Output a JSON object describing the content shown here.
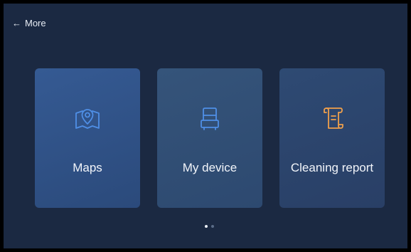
{
  "header": {
    "back_icon": "arrow-left-icon",
    "title": "More"
  },
  "cards": [
    {
      "label": "Maps",
      "icon": "map-pin-icon",
      "icon_color": "#4f8fe6"
    },
    {
      "label": "My device",
      "icon": "robot-device-icon",
      "icon_color": "#4f8fe6"
    },
    {
      "label": "Cleaning report",
      "icon": "scroll-report-icon",
      "icon_color": "#f0a04b"
    }
  ],
  "pagination": {
    "total": 2,
    "active": 1
  },
  "colors": {
    "background": "#1b2942",
    "accent_blue": "#4f8fe6",
    "accent_orange": "#f0a04b",
    "text": "#f2f5fa"
  }
}
